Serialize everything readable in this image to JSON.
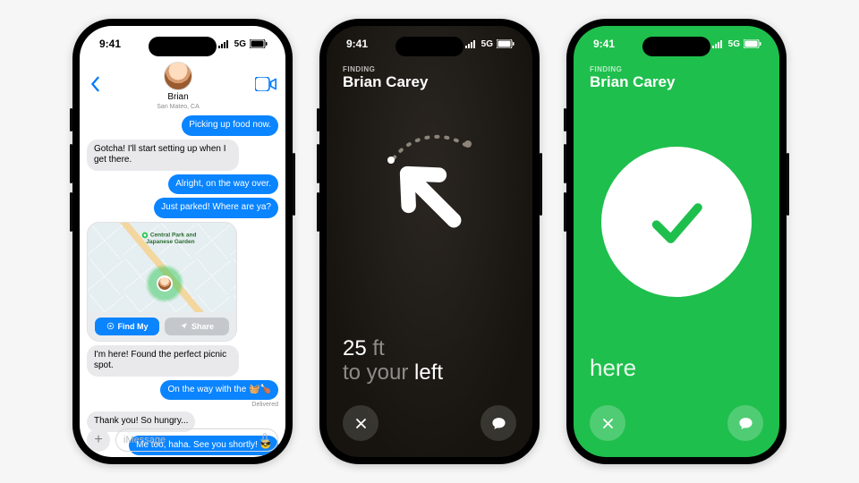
{
  "status": {
    "time": "9:41",
    "network": "5G"
  },
  "phone1": {
    "contact_name": "Brian",
    "contact_location": "San Mateo, CA",
    "map_place_line1": "Central Park and",
    "map_place_line2": "Japanese Garden",
    "findmy_label": "Find My",
    "share_label": "Share",
    "messages": {
      "m1": "Picking up food now.",
      "m2": "Gotcha! I'll start setting up when I get there.",
      "m3": "Alright, on the way over.",
      "m4": "Just parked! Where are ya?",
      "m5": "I'm here! Found the perfect picnic spot.",
      "m6": "On the way with the 🧺🍗",
      "m7": "Thank you! So hungry...",
      "m8": "Me too, haha. See you shortly! 😎"
    },
    "delivered": "Delivered",
    "composer_placeholder": "iMessage"
  },
  "phone2": {
    "finding_label": "FINDING",
    "finding_name": "Brian Carey",
    "distance_value": "25",
    "distance_unit": "ft",
    "direction_prefix": "to your ",
    "direction_word": "left"
  },
  "phone3": {
    "finding_label": "FINDING",
    "finding_name": "Brian Carey",
    "status_word": "here"
  }
}
